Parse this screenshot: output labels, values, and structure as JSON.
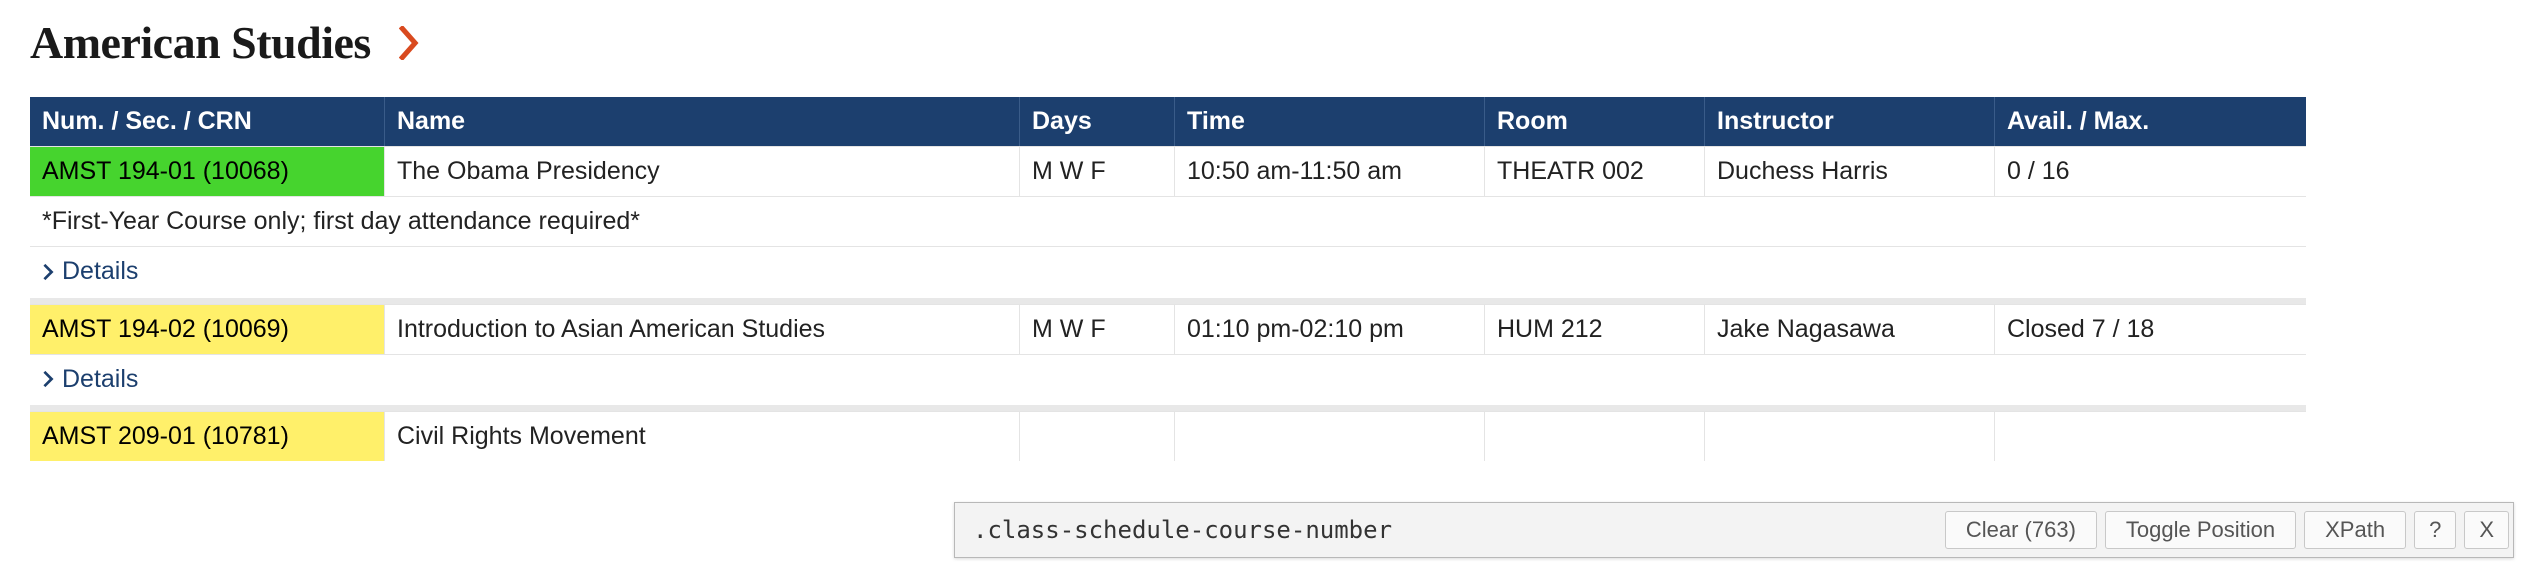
{
  "heading": "American Studies",
  "table": {
    "headers": {
      "num": "Num. / Sec. / CRN",
      "name": "Name",
      "days": "Days",
      "time": "Time",
      "room": "Room",
      "instructor": "Instructor",
      "avail": "Avail. / Max."
    },
    "rows": [
      {
        "num": "AMST 194-01 (10068)",
        "num_color": "green",
        "name": "The Obama Presidency",
        "days": "M W F",
        "time": "10:50 am-11:50 am",
        "room": "THEATR 002",
        "instructor": "Duchess Harris",
        "avail": "0 / 16",
        "note": "*First-Year Course only; first day attendance required*",
        "details_label": "Details"
      },
      {
        "num": "AMST 194-02 (10069)",
        "num_color": "yellow",
        "name": "Introduction to Asian American Studies",
        "days": "M W F",
        "time": "01:10 pm-02:10 pm",
        "room": "HUM 212",
        "instructor": "Jake Nagasawa",
        "avail": "Closed 7 / 18",
        "details_label": "Details"
      },
      {
        "num": "AMST 209-01 (10781)",
        "num_color": "yellow",
        "name": "Civil Rights Movement",
        "days": "",
        "time": "",
        "room": "",
        "instructor": "",
        "avail": ""
      }
    ]
  },
  "inspector": {
    "input_value": ".class-schedule-course-number",
    "clear_label": "Clear (763)",
    "toggle_label": "Toggle Position",
    "xpath_label": "XPath",
    "help_label": "?",
    "close_label": "X"
  }
}
